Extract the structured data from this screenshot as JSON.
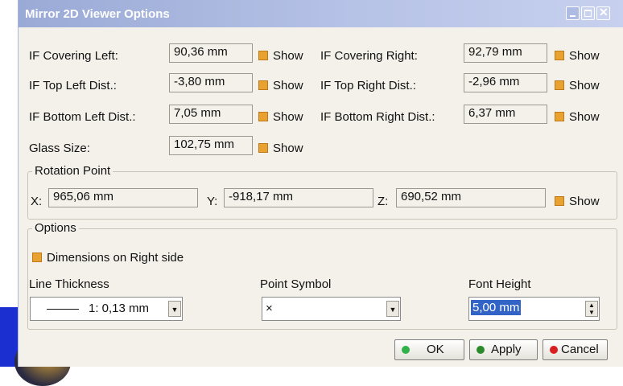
{
  "window": {
    "title": "Mirror 2D Viewer Options"
  },
  "distances": [
    {
      "label": "IF Covering Left:",
      "value": "90,36 mm",
      "show": "Show"
    },
    {
      "label": "IF Top Left Dist.:",
      "value": "-3,80 mm",
      "show": "Show"
    },
    {
      "label": "IF Bottom Left Dist.:",
      "value": "7,05 mm",
      "show": "Show"
    },
    {
      "label": "Glass Size:",
      "value": "102,75 mm",
      "show": "Show"
    },
    {
      "label": "IF Covering Right:",
      "value": "92,79 mm",
      "show": "Show"
    },
    {
      "label": "IF Top Right Dist.:",
      "value": "-2,96 mm",
      "show": "Show"
    },
    {
      "label": "IF Bottom Right Dist.:",
      "value": "6,37 mm",
      "show": "Show"
    }
  ],
  "rotation_point": {
    "title": "Rotation Point",
    "x_label": "X:",
    "x_value": "965,06 mm",
    "y_label": "Y:",
    "y_value": "-918,17 mm",
    "z_label": "Z:",
    "z_value": "690,52 mm",
    "show": "Show"
  },
  "options": {
    "title": "Options",
    "dimensions_right": "Dimensions on Right side",
    "line_thickness_label": "Line Thickness",
    "line_thickness_value": "1: 0,13 mm",
    "point_symbol_label": "Point Symbol",
    "point_symbol_value": "×",
    "font_height_label": "Font Height",
    "font_height_value": "5,00 mm"
  },
  "buttons": {
    "ok": "OK",
    "apply": "Apply",
    "cancel": "Cancel"
  },
  "colors": {
    "checkbox": "#e9a230",
    "ok_dot": "#2fb24a",
    "apply_dot": "#2b8a2b",
    "cancel_dot": "#d81e1e",
    "selection": "#3264c8"
  }
}
